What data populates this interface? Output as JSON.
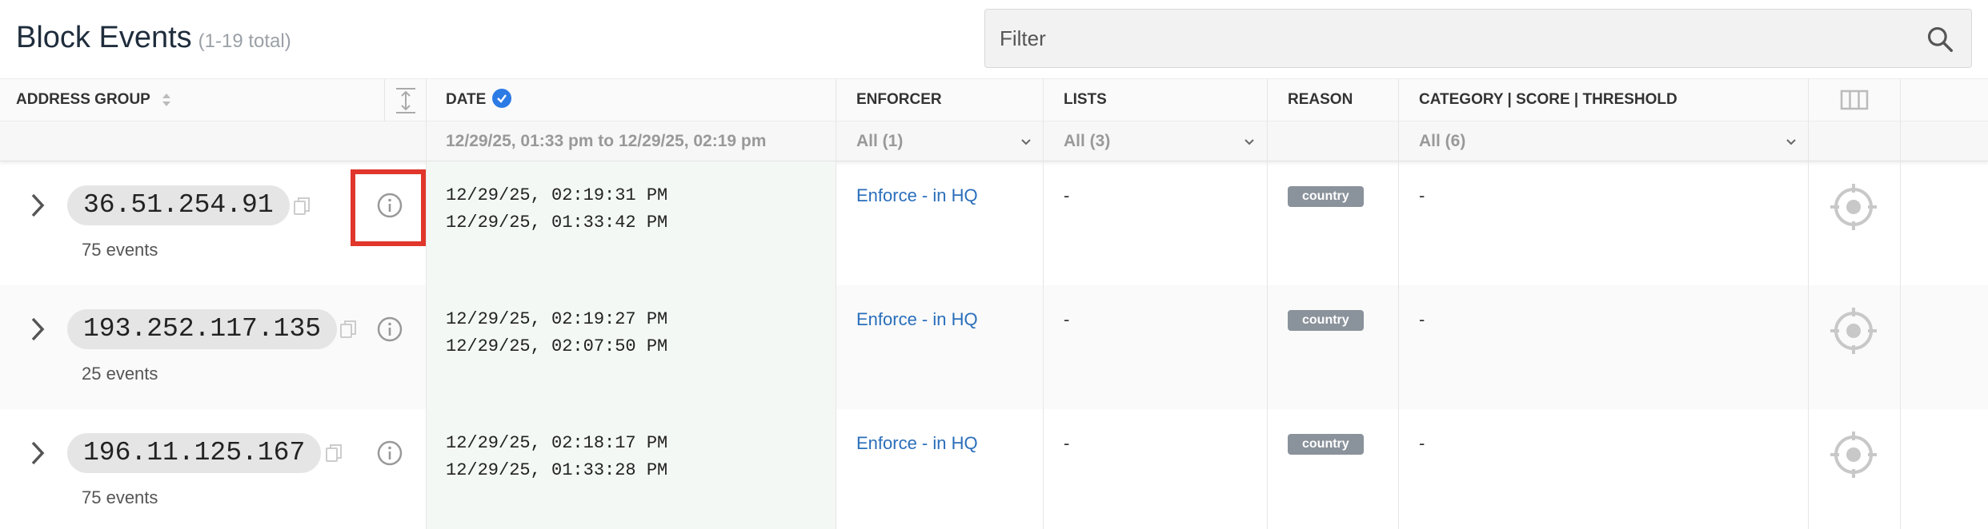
{
  "header": {
    "title": "Block Events",
    "count": "(1-19 total)",
    "filter_placeholder": "Filter"
  },
  "columns": {
    "address_group": "ADDRESS GROUP",
    "date": "DATE",
    "enforcer": "ENFORCER",
    "lists": "LISTS",
    "reason": "REASON",
    "category": "CATEGORY | SCORE | THRESHOLD"
  },
  "filters": {
    "date_range": "12/29/25, 01:33 pm to 12/29/25, 02:19 pm",
    "enforcer": "All (1)",
    "lists": "All (3)",
    "category": "All (6)"
  },
  "rows": [
    {
      "ip": "36.51.254.91",
      "events": "75 events",
      "date_last": "12/29/25, 02:19:31 PM",
      "date_first": "12/29/25, 01:33:42 PM",
      "enforcer": "Enforce - in HQ",
      "lists": "-",
      "reason": "country",
      "category": "-"
    },
    {
      "ip": "193.252.117.135",
      "events": "25 events",
      "date_last": "12/29/25, 02:19:27 PM",
      "date_first": "12/29/25, 02:07:50 PM",
      "enforcer": "Enforce - in HQ",
      "lists": "-",
      "reason": "country",
      "category": "-"
    },
    {
      "ip": "196.11.125.167",
      "events": "75 events",
      "date_last": "12/29/25, 02:18:17 PM",
      "date_first": "12/29/25, 01:33:28 PM",
      "enforcer": "Enforce - in HQ",
      "lists": "-",
      "reason": "country",
      "category": "-"
    }
  ],
  "colors": {
    "accent": "#2c7be5",
    "link": "#2a6ebb",
    "badge": "#8a929b",
    "highlight": "#e0362c",
    "date_column_bg": "#f3f8f5"
  },
  "icons": [
    "search-icon",
    "sort-icon",
    "check-circle-icon",
    "expand-rows-icon",
    "columns-icon",
    "chevron-down-icon",
    "chevron-right-icon",
    "copy-icon",
    "info-icon",
    "target-icon"
  ]
}
